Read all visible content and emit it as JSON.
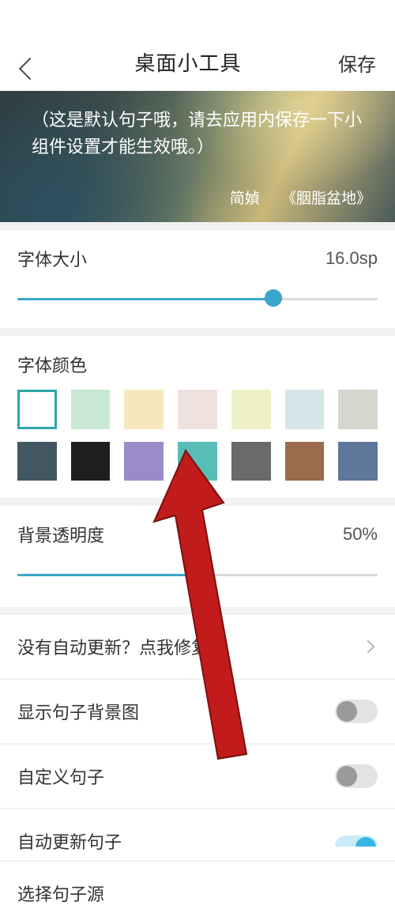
{
  "header": {
    "title": "桌面小工具",
    "save": "保存"
  },
  "preview": {
    "sentence": "（这是默认句子哦，请去应用内保存一下小组件设置才能生效哦。）",
    "author": "简媜",
    "source": "《胭脂盆地》"
  },
  "fontSize": {
    "label": "字体大小",
    "value": "16.0sp",
    "percent": 71
  },
  "fontColor": {
    "label": "字体颜色",
    "swatches": [
      "#ffffff",
      "#c9e8d2",
      "#f6e7be",
      "#efe1de",
      "#eef1c8",
      "#d6e5e8",
      "#d3d7cd",
      "#435763",
      "#1f1f1f",
      "#9c8bc9",
      "#58bcb7",
      "#6b6969",
      "#9a6b4c",
      "#5e779a"
    ],
    "selected": 0
  },
  "bgOpacity": {
    "label": "背景透明度",
    "value": "50%",
    "percent": 50
  },
  "rows": {
    "fix": "没有自动更新？点我修复",
    "bgimg": "显示句子背景图",
    "custom": "自定义句子",
    "auto": "自动更新句子",
    "source": "选择句子源"
  },
  "toggles": {
    "bgimg": false,
    "custom": false,
    "auto": true
  }
}
